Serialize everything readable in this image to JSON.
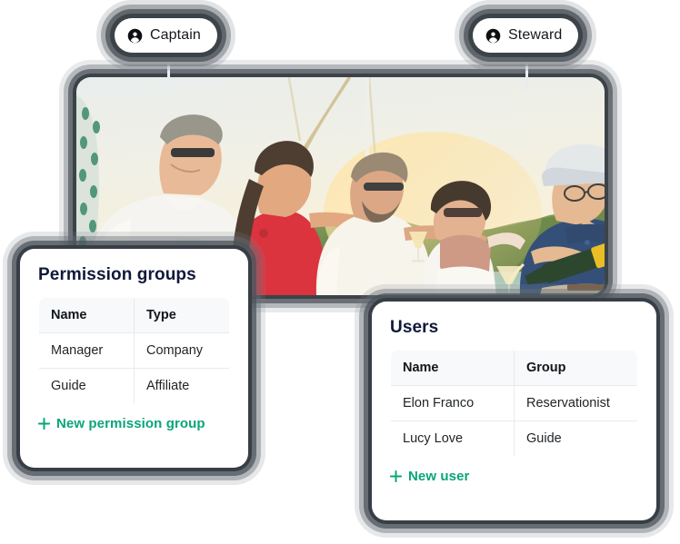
{
  "accent_green": "#0AA578",
  "title_navy": "#10193A",
  "badges": [
    {
      "label": "Captain",
      "icon": "person-circle-icon"
    },
    {
      "label": "Steward",
      "icon": "person-circle-icon"
    }
  ],
  "photo": {
    "alt": "Group of people celebrating with champagne on a yacht at sunset"
  },
  "permission_groups_card": {
    "title": "Permission groups",
    "columns": [
      "Name",
      "Type"
    ],
    "rows": [
      [
        "Manager",
        "Company"
      ],
      [
        "Guide",
        "Affiliate"
      ]
    ],
    "add_label": "New permission group",
    "add_icon": "plus-icon"
  },
  "users_card": {
    "title": "Users",
    "columns": [
      "Name",
      "Group"
    ],
    "rows": [
      [
        "Elon Franco",
        "Reservationist"
      ],
      [
        "Lucy Love",
        "Guide"
      ]
    ],
    "add_label": "New user",
    "add_icon": "plus-icon"
  }
}
